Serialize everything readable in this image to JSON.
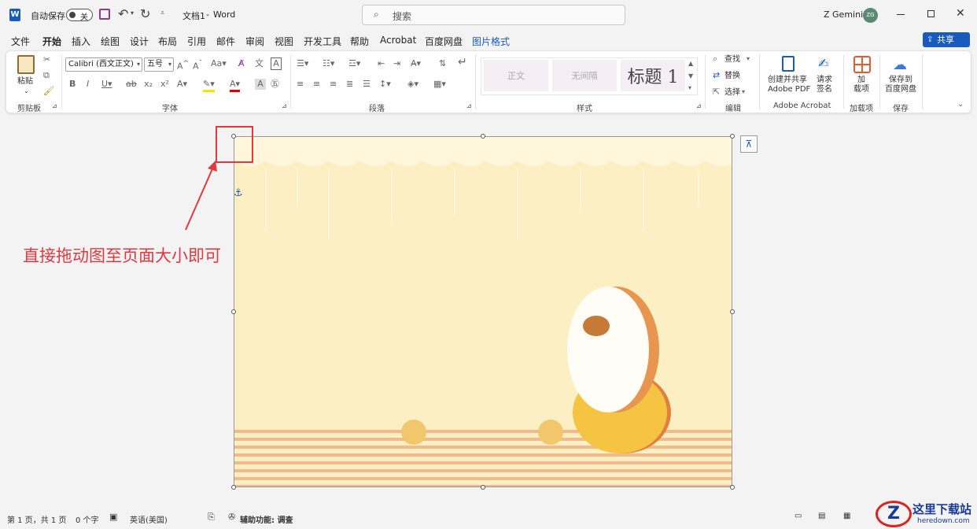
{
  "titlebar": {
    "autosave_label": "自动保存",
    "autosave_state": "关",
    "doc_name": "文档1",
    "separator": "-",
    "app_name": "Word",
    "search_placeholder": "搜索",
    "user_name": "Z Gemini",
    "user_initials": "ZG"
  },
  "tabs": [
    "文件",
    "开始",
    "插入",
    "绘图",
    "设计",
    "布局",
    "引用",
    "邮件",
    "审阅",
    "视图",
    "开发工具",
    "帮助",
    "Acrobat",
    "百度网盘",
    "图片格式"
  ],
  "share_label": "共享",
  "ribbon": {
    "clipboard": {
      "paste": "粘贴",
      "group": "剪贴板"
    },
    "font": {
      "name": "Calibri (西文正文)",
      "size": "五号",
      "group": "字体"
    },
    "paragraph": {
      "group": "段落"
    },
    "styles": {
      "items": [
        "正文",
        "无间隔",
        "标题 1"
      ],
      "group": "样式"
    },
    "editing": {
      "find": "查找",
      "replace": "替换",
      "select": "选择",
      "group": "编辑"
    },
    "acrobat": {
      "create": "创建并共享",
      "create2": "Adobe PDF",
      "sign": "请求",
      "sign2": "签名",
      "group": "Adobe Acrobat"
    },
    "addins": {
      "label": "加",
      "label2": "载项",
      "group": "加载项"
    },
    "save": {
      "label": "保存到",
      "label2": "百度网盘",
      "group": "保存"
    }
  },
  "annotation": "直接拖动图至页面大小即可",
  "status": {
    "page": "第 1 页，共 1 页",
    "words": "0 个字",
    "lang": "英语(美国)",
    "accessibility": "辅助功能: 调查"
  },
  "watermark": {
    "cn": "这里下载站",
    "en": "heredown.com"
  },
  "colors": {
    "accent": "#185abd",
    "annotation": "#e0393e",
    "image_bg": "#fcefc4"
  }
}
